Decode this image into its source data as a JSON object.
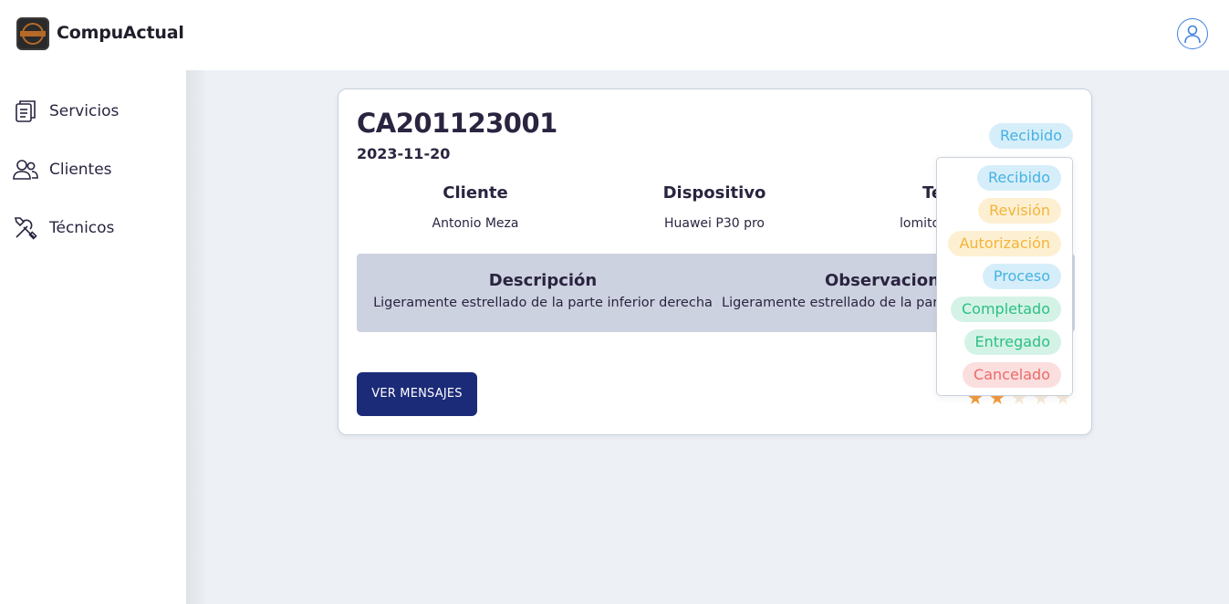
{
  "app": {
    "brand": "CompuActual"
  },
  "sidebar": {
    "items": [
      {
        "label": "Servicios",
        "icon": "clipboard-list-icon"
      },
      {
        "label": "Clientes",
        "icon": "users-icon"
      },
      {
        "label": "Técnicos",
        "icon": "tools-icon"
      }
    ]
  },
  "service": {
    "code": "CA201123001",
    "date": "2023-11-20",
    "status": "Recibido",
    "columns": [
      {
        "header": "Cliente",
        "value": "Antonio Meza"
      },
      {
        "header": "Dispositivo",
        "value": "Huawei P30 pro"
      },
      {
        "header": "Te",
        "value": "lomito"
      }
    ],
    "description": {
      "header": "Descripción",
      "value": "Ligeramente estrellado de la parte inferior derecha"
    },
    "observations": {
      "header": "Observacione",
      "value": "Ligeramente estrellado de la part"
    },
    "messages_button": "VER MENSAJES",
    "rating": 2,
    "rating_max": 5
  },
  "status_menu": {
    "options": [
      {
        "label": "Recibido",
        "color": "blue"
      },
      {
        "label": "Revisión",
        "color": "yellow"
      },
      {
        "label": "Autorización",
        "color": "yellow"
      },
      {
        "label": "Proceso",
        "color": "blue"
      },
      {
        "label": "Completado",
        "color": "green"
      },
      {
        "label": "Entregado",
        "color": "green"
      },
      {
        "label": "Cancelado",
        "color": "red"
      }
    ]
  },
  "colors": {
    "primary": "#1c2b78",
    "accent": "#3f7fe0",
    "star": "#f39a3c"
  }
}
